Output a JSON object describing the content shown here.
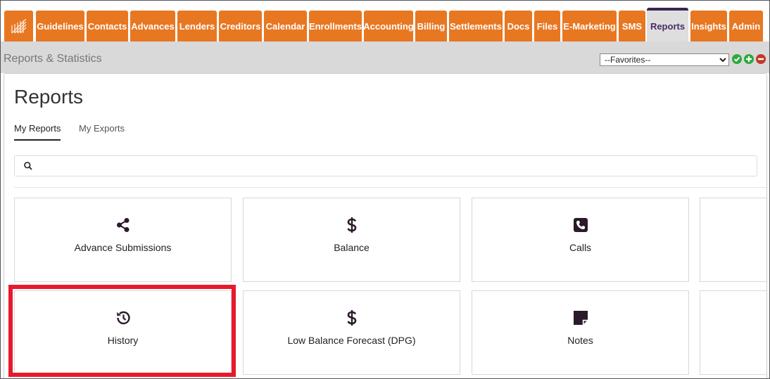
{
  "nav": {
    "tabs": [
      {
        "label": "Guidelines"
      },
      {
        "label": "Contacts"
      },
      {
        "label": "Advances"
      },
      {
        "label": "Lenders"
      },
      {
        "label": "Creditors"
      },
      {
        "label": "Calendar"
      },
      {
        "label": "Enrollments"
      },
      {
        "label": "Accounting"
      },
      {
        "label": "Billing"
      },
      {
        "label": "Settlements"
      },
      {
        "label": "Docs"
      },
      {
        "label": "Files"
      },
      {
        "label": "E-Marketing"
      },
      {
        "label": "SMS"
      },
      {
        "label": "Reports"
      },
      {
        "label": "Insights"
      },
      {
        "label": "Admin"
      }
    ],
    "active": "Reports"
  },
  "subheader": {
    "title": "Reports & Statistics",
    "favorites_selected": "--Favorites--"
  },
  "reports": {
    "title": "Reports",
    "tabs": [
      {
        "label": "My Reports"
      },
      {
        "label": "My Exports"
      }
    ],
    "search_placeholder": "",
    "tiles": [
      {
        "label": "Advance Submissions",
        "icon": "share-icon"
      },
      {
        "label": "Balance",
        "icon": "dollar-icon"
      },
      {
        "label": "Calls",
        "icon": "phone-square-icon"
      },
      {
        "label": "",
        "icon": ""
      },
      {
        "label": "History",
        "icon": "history-icon"
      },
      {
        "label": "Low Balance Forecast (DPG)",
        "icon": "dollar-icon"
      },
      {
        "label": "Notes",
        "icon": "sticky-note-icon"
      },
      {
        "label": "",
        "icon": ""
      }
    ]
  },
  "colors": {
    "nav_orange": "#e87722",
    "active_tab_text": "#4a2a6a",
    "highlight_red": "#e8192c",
    "green": "#2eaa3c",
    "red": "#c0392b"
  }
}
